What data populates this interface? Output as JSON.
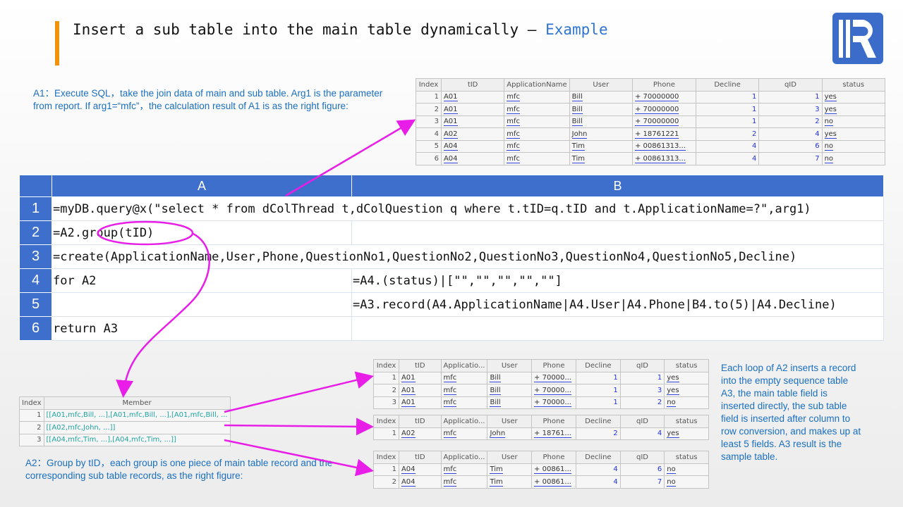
{
  "header": {
    "title": "Insert a sub table into the main table dynamically",
    "dash": " — ",
    "example": "Example"
  },
  "notes": {
    "a1": "A1：Execute SQL，take the join data of main and sub table. Arg1 is the parameter from report. If arg1=“mfc”，the calculation result of A1 is as the right figure:",
    "a2": "A2：Group by tID，each group is one piece of main table record and the corresponding sub table records, as the right figure:",
    "a3": "Each loop of  A2 inserts a record into the empty sequence table A3, the main table field is inserted directly, the sub table field is inserted after column to row conversion, and makes up at least 5 fields. A3 result is the sample table."
  },
  "grid": {
    "columns": [
      "A",
      "B"
    ],
    "rows": [
      {
        "n": "1",
        "a": "=myDB.query@x(\"select * from dColThread t,dColQuestion q where t.tID=q.tID and t.ApplicationName=?\",arg1)",
        "b": ""
      },
      {
        "n": "2",
        "a": "=A2.group(tID)",
        "b": ""
      },
      {
        "n": "3",
        "a": "=create(ApplicationName,User,Phone,QuestionNo1,QuestionNo2,QuestionNo3,QuestionNo4,QuestionNo5,Decline)",
        "b": ""
      },
      {
        "n": "4",
        "a": "for A2",
        "b": "=A4.(status)|[\"\",\"\",\"\",\"\",\"\"]"
      },
      {
        "n": "5",
        "a": "",
        "b": "=A3.record(A4.ApplicationName|A4.User|A4.Phone|B4.to(5)|A4.Decline)"
      },
      {
        "n": "6",
        "a": "return A3",
        "b": ""
      }
    ]
  },
  "a1_table": {
    "headers": [
      "Index",
      "tID",
      "ApplicationName",
      "User",
      "Phone",
      "Decline",
      "qID",
      "status"
    ],
    "rows": [
      [
        "1",
        "A01",
        "mfc",
        "Bill",
        "+ 70000000",
        "1",
        "1",
        "yes"
      ],
      [
        "2",
        "A01",
        "mfc",
        "Bill",
        "+ 70000000",
        "1",
        "3",
        "yes"
      ],
      [
        "3",
        "A01",
        "mfc",
        "Bill",
        "+ 70000000",
        "1",
        "2",
        "no"
      ],
      [
        "4",
        "A02",
        "mfc",
        "John",
        "+ 18761221",
        "2",
        "4",
        "yes"
      ],
      [
        "5",
        "A04",
        "mfc",
        "Tim",
        "+ 00861313...",
        "4",
        "6",
        "no"
      ],
      [
        "6",
        "A04",
        "mfc",
        "Tim",
        "+ 00861313...",
        "4",
        "7",
        "no"
      ]
    ]
  },
  "a2_table": {
    "headers": [
      "Index",
      "Member"
    ],
    "rows": [
      [
        "1",
        "[[A01,mfc,Bill, ...],[A01,mfc,Bill, ...],[A01,mfc,Bill, ..."
      ],
      [
        "2",
        "[[A02,mfc,John, ...]]"
      ],
      [
        "3",
        "[[A04,mfc,Tim, ...],[A04,mfc,Tim, ...]]"
      ]
    ]
  },
  "group_tables": [
    {
      "headers": [
        "Index",
        "tID",
        "Applicatio...",
        "User",
        "Phone",
        "Decline",
        "qID",
        "status"
      ],
      "rows": [
        [
          "1",
          "A01",
          "mfc",
          "Bill",
          "+ 70000...",
          "1",
          "1",
          "yes"
        ],
        [
          "2",
          "A01",
          "mfc",
          "Bill",
          "+ 70000...",
          "1",
          "3",
          "yes"
        ],
        [
          "3",
          "A01",
          "mfc",
          "Bill",
          "+ 70000...",
          "1",
          "2",
          "no"
        ]
      ]
    },
    {
      "headers": [
        "Index",
        "tID",
        "Applicatio...",
        "User",
        "Phone",
        "Decline",
        "qID",
        "status"
      ],
      "rows": [
        [
          "1",
          "A02",
          "mfc",
          "John",
          "+ 18761...",
          "2",
          "4",
          "yes"
        ]
      ]
    },
    {
      "headers": [
        "Index",
        "tID",
        "Applicatio...",
        "User",
        "Phone",
        "Decline",
        "qID",
        "status"
      ],
      "rows": [
        [
          "1",
          "A04",
          "mfc",
          "Tim",
          "+ 00861...",
          "4",
          "6",
          "no"
        ],
        [
          "2",
          "A04",
          "mfc",
          "Tim",
          "+ 00861...",
          "4",
          "7",
          "no"
        ]
      ]
    }
  ],
  "colors": {
    "accent": "#f0920a",
    "brand": "#3e6fcc",
    "arrow": "#e81ee8",
    "note": "#1a6fc0"
  }
}
